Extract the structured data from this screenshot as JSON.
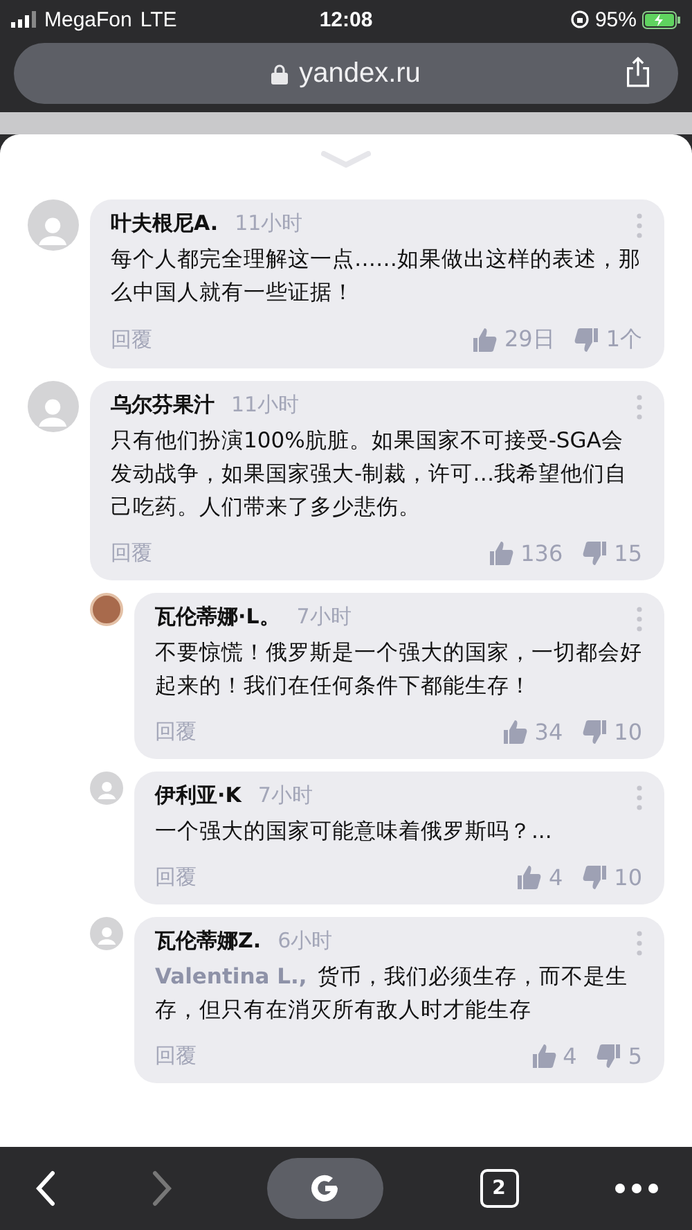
{
  "status_bar": {
    "carrier": "MegaFon",
    "network": "LTE",
    "time": "12:08",
    "battery": "95%"
  },
  "address_bar": {
    "url": "yandex.ru"
  },
  "comments": [
    {
      "author": "叶夫根尼A.",
      "time": "11小时",
      "avatar": {
        "kind": "placeholder"
      },
      "text": "每个人都完全理解这一点……如果做出这样的表述，那么中国人就有一些证据！",
      "reply": "回覆",
      "likes": "29日",
      "dislikes": "1个"
    },
    {
      "author": "乌尔芬果汁",
      "time": "11小时",
      "avatar": {
        "kind": "placeholder"
      },
      "text": "只有他们扮演100%肮脏。如果国家不可接受-SGA会发动战争，如果国家强大-制裁，许可…我希望他们自己吃药。人们带来了多少悲伤。",
      "reply": "回覆",
      "likes": "136",
      "dislikes": "15",
      "children": [
        {
          "author": "瓦伦蒂娜·L。",
          "time": "7小时",
          "avatar": {
            "kind": "photo"
          },
          "text": "不要惊慌！俄罗斯是一个强大的国家，一切都会好起来的！我们在任何条件下都能生存！",
          "reply": "回覆",
          "likes": "34",
          "dislikes": "10"
        },
        {
          "author": "伊利亚·K",
          "time": "7小时",
          "avatar": {
            "kind": "placeholder"
          },
          "text": "一个强大的国家可能意味着俄罗斯吗？...",
          "reply": "回覆",
          "likes": "4",
          "dislikes": "10"
        },
        {
          "author": "瓦伦蒂娜Z.",
          "time": "6小时",
          "avatar": {
            "kind": "placeholder"
          },
          "mention": "Valentina L.,",
          "text": "货币，我们必须生存，而不是生存，但只有在消灭所有敌人时才能生存",
          "reply": "回覆",
          "likes": "4",
          "dislikes": "5"
        }
      ]
    }
  ],
  "toolbar": {
    "back_disabled": false,
    "forward_disabled": true,
    "tabs_count": "2"
  }
}
